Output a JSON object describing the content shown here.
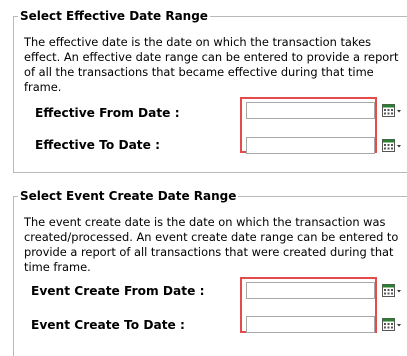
{
  "effective": {
    "legend": "Select Effective Date Range",
    "description": "The effective date is the date on which the transaction takes effect.  An effective date range can be entered to provide a report of all the transactions that became effective during that time frame.",
    "from_label": "Effective From Date :",
    "from_value": "",
    "to_label": "Effective To Date :",
    "to_value": ""
  },
  "event_create": {
    "legend": "Select Event Create Date Range",
    "description": "The event create date is the date on which the transaction was created/processed. An event create date range can be entered to provide a report of all transactions that were created during that time frame.",
    "from_label": "Event Create From Date :",
    "from_value": "",
    "to_label": "Event Create To Date :",
    "to_value": ""
  },
  "icons": {
    "calendar": "calendar-dropdown-icon"
  },
  "colors": {
    "highlight": "#e44b4b",
    "calendar_green": "#2e7d32"
  }
}
